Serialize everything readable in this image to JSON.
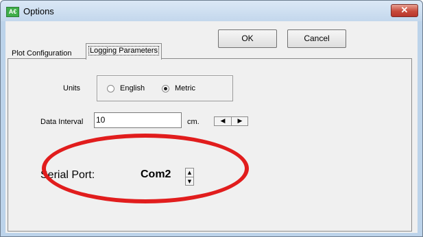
{
  "window": {
    "title": "Options",
    "app_icon_text": "A€",
    "close_symbol": "✕"
  },
  "buttons": {
    "ok_label": "OK",
    "cancel_label": "Cancel"
  },
  "tabs": [
    {
      "label": "Plot Configuration",
      "selected": false
    },
    {
      "label": "Logging Parameters",
      "selected": true
    }
  ],
  "logging": {
    "units": {
      "label": "Units",
      "options": [
        "English",
        "Metric"
      ],
      "selected": "Metric"
    },
    "data_interval": {
      "label": "Data Interval",
      "value": "10",
      "unit": "cm.",
      "left_arrow": "◀",
      "right_arrow": "▶"
    },
    "serial_port": {
      "label": "Serial Port:",
      "value": "Com2",
      "up_arrow": "▲",
      "down_arrow": "▼"
    }
  },
  "colors": {
    "highlight_ellipse": "#e11d1d",
    "titlebar": "#c3d7ec",
    "dialog_bg": "#f0f0f0"
  }
}
